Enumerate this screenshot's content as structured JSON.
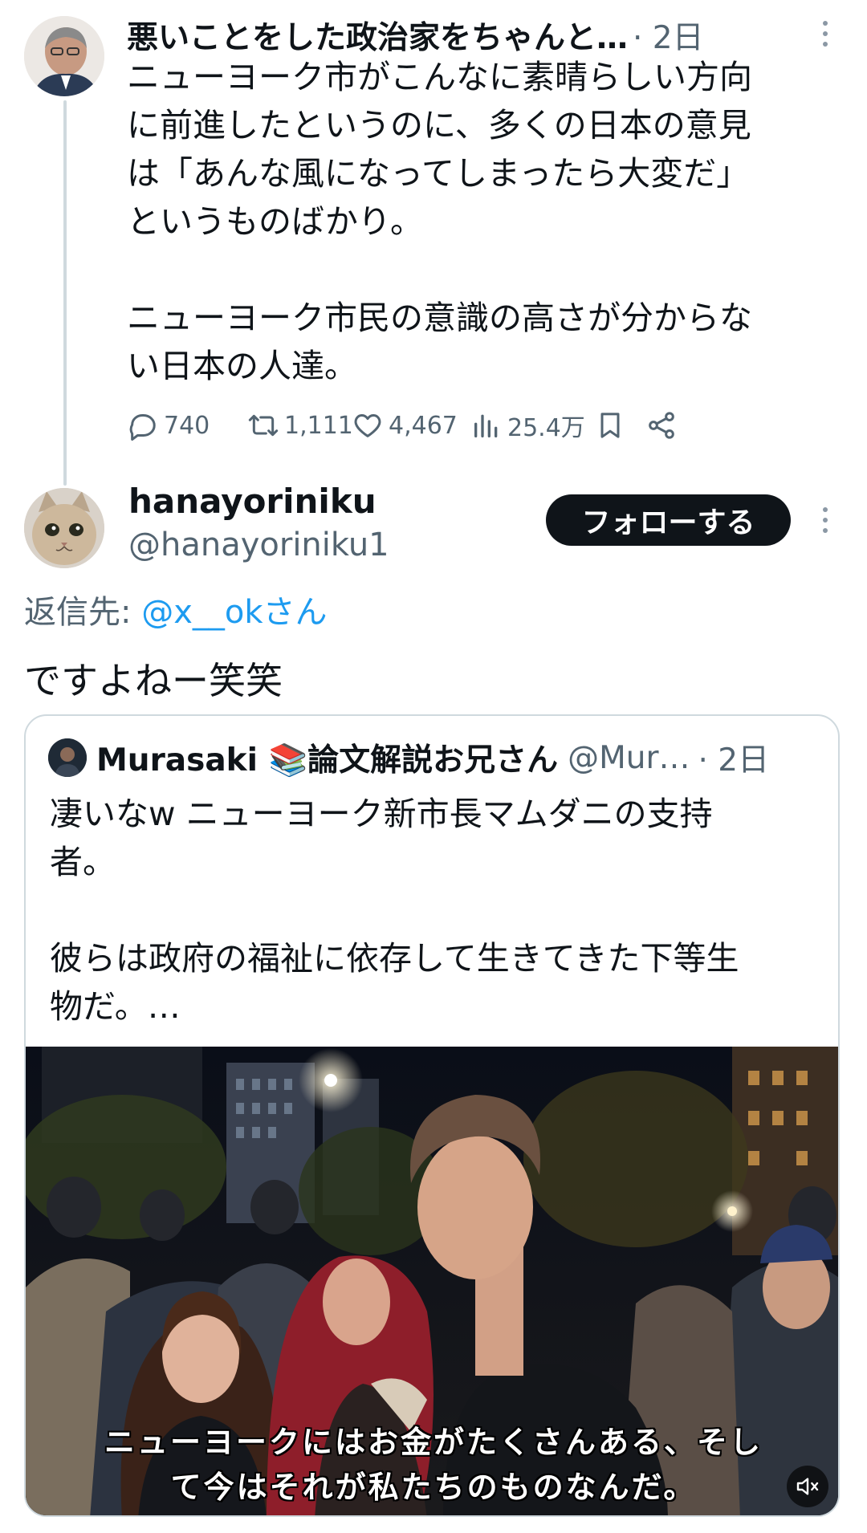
{
  "parent_tweet": {
    "display_name": "悪いことをした政治家をちゃんと…",
    "time": "· 2日",
    "text": "ニューヨーク市がこんなに素晴らしい方向\nに前進したというのに、多くの日本の意見\nは「あんな風になってしまったら大変だ」\nというものばかり。\n\nニューヨーク市民の意識の高さが分からな\nい日本の人達。",
    "stats": {
      "replies": "740",
      "retweets": "1,111",
      "likes": "4,467",
      "views": "25.4万"
    },
    "icons": [
      "reply-icon",
      "retweet-icon",
      "like-icon",
      "views-icon",
      "bookmark-icon",
      "share-icon",
      "more-icon"
    ]
  },
  "reply_tweet": {
    "display_name": "hanayoriniku",
    "handle": "@hanayoriniku1",
    "follow_label": "フォローする",
    "reply_to_prefix": "返信先: ",
    "reply_to_mention": "@x__okさん",
    "text": "ですよねー笑笑"
  },
  "quoted_tweet": {
    "display_name": "Murasaki 📚論文解説お兄さん",
    "handle": "@Mur…",
    "time": "· 2日",
    "text": "凄いなw ニューヨーク新市長マムダニの支持\n者。\n\n彼らは政府の福祉に依存して生きてきた下等生\n物だ。…",
    "video_subtitle_line1": "ニューヨークにはお金がたくさんある、そし",
    "video_subtitle_line2": "て今はそれが私たちのものなんだ。",
    "video_icon": "mute-icon"
  },
  "colors": {
    "text_primary": "#0f1419",
    "text_secondary": "#536471",
    "link": "#1d9bf0",
    "border": "#cfd9de",
    "button_bg": "#0f1419"
  }
}
